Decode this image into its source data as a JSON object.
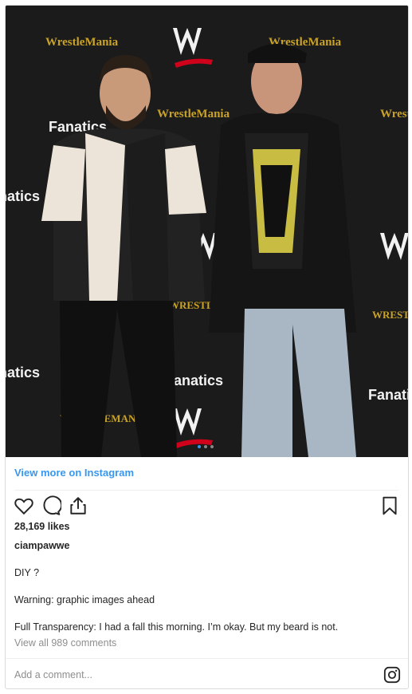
{
  "post": {
    "backdrop": {
      "logo_text_1": "WrestleMania",
      "logo_text_2": "WrestleMania",
      "logo_text_3": "WrestleMania",
      "logo_text_4": "WrestleMania",
      "logo_text_5": "WRESTLEM",
      "logo_text_6": "WRESTLEMANIA",
      "logo_text_7": "WRESTLEMANIA",
      "sponsor_1": "Fanatics",
      "sponsor_2": "Fanatics",
      "sponsor_3": "Fanatics",
      "sponsor_4": "Fanatics",
      "sponsor_5": "Fanatics",
      "colors": {
        "backdrop": "#1a1a1a",
        "wwe_red": "#d0021b",
        "gold": "#c9a227"
      }
    },
    "view_more": "View more on Instagram",
    "icons": [
      "heart-icon",
      "comment-icon",
      "share-icon",
      "bookmark-icon"
    ],
    "likes": "28,169 likes",
    "owner": "ciampawwe",
    "caption": [
      "DIY ?",
      "Warning: graphic images ahead",
      "Full Transparency: I had a fall this morning. I’m okay. But my beard is not."
    ],
    "view_comments": "View all 989 comments",
    "comment_placeholder": "Add a comment...",
    "accent": "#3897f0"
  }
}
